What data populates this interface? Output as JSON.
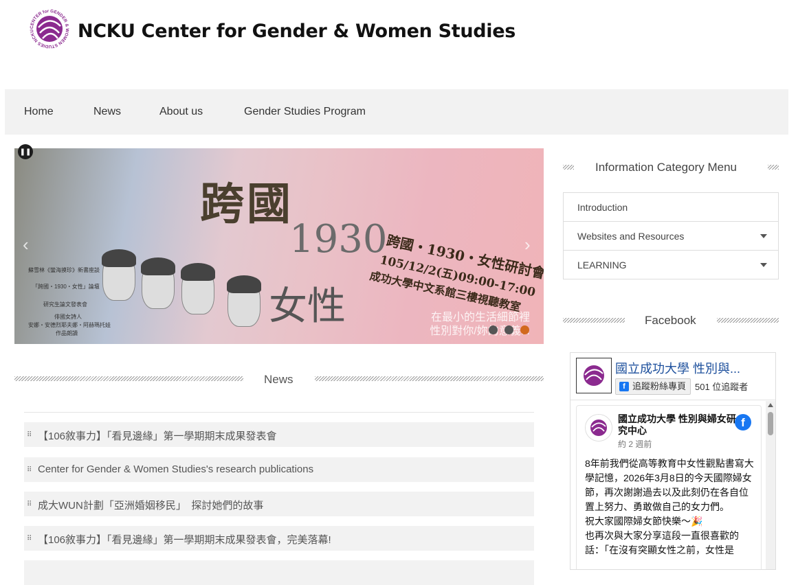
{
  "site": {
    "title": "NCKU Center for Gender & Women Studies",
    "logo_text": "CENTER for GENDER & WOMEN STUDIES NCKU"
  },
  "nav": {
    "items": [
      "Home",
      "News",
      "About us",
      "Gender Studies Program"
    ]
  },
  "slider": {
    "title": "跨國",
    "year": "1930",
    "subtitle": "女性",
    "event_line1": "跨國・1930・女性研討會",
    "event_line2": "105/12/2(五)09:00-17:00",
    "event_line3": "成功大學中文系館三樓視聽教室",
    "notes": [
      "蘇雪林《蠻海摸珍》新書座談",
      "「跨國・1930・女性」論壇",
      "研究生論文發表會",
      "俳國女詩人",
      "安娜・安德烈耶夫娜・阿赫瑪托娃",
      "作品朗讀"
    ],
    "bottom_line1": "在最小的生活細節裡",
    "bottom_line2": "性別對你/妳的意義...",
    "pause_icon": "pause-icon",
    "prev_icon": "chevron-left-icon",
    "next_icon": "chevron-right-icon",
    "dot_count": 3,
    "active_dot": 2
  },
  "news": {
    "heading": "News",
    "items": [
      "【106敘事力】「看見邊緣」第一學期期末成果發表會",
      "Center for Gender & Women Studies's research publications",
      "成大WUN計劃「亞洲婚姻移民」　探討她們的故事",
      "【106敘事力】「看見邊緣」第一學期期末成果發表會，完美落幕!"
    ]
  },
  "sidebar": {
    "category_heading": "Information Category Menu",
    "categories": [
      {
        "label": "Introduction",
        "has_children": false
      },
      {
        "label": "Websites and Resources",
        "has_children": true
      },
      {
        "label": "LEARNING",
        "has_children": true
      }
    ],
    "facebook_heading": "Facebook"
  },
  "facebook": {
    "page_name": "國立成功大學 性別與...",
    "follow_label": "追蹤粉絲專頁",
    "follower_count": "501 位追蹤者",
    "post": {
      "author": "國立成功大學 性別與婦女研究中心",
      "time": "約 2 週前",
      "body": "8年前我們從高等教育中女性觀點書寫大學記憶，2026年3月8日的今天國際婦女節，再次謝謝過去以及此刻仍在各自位置上努力、勇敢做自己的女力們。\n祝大家國際婦女節快樂～🎉\n也再次與大家分享這段一直很喜歡的話：「在沒有突顯女性之前，女性是"
    }
  },
  "colors": {
    "nav_bg": "#f2f2f2",
    "news_bg": "#f2f2f2",
    "accent_dot": "#d2691e",
    "fb_blue": "#1877f2",
    "logo_purple": "#8b2a8f"
  }
}
